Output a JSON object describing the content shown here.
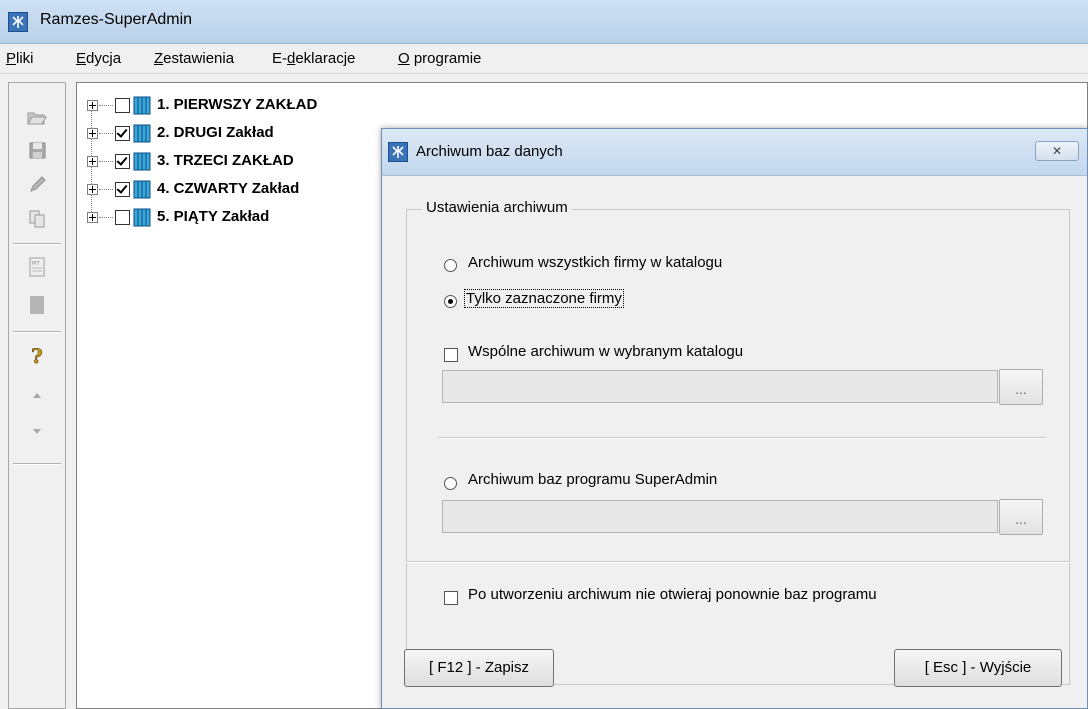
{
  "window": {
    "title": "Ramzes-SuperAdmin"
  },
  "menu": [
    {
      "label": "Pliki",
      "accel": "P"
    },
    {
      "label": "Edycja",
      "accel": "E"
    },
    {
      "label": "Zestawienia",
      "accel": "Z"
    },
    {
      "label": "E-deklaracje",
      "accel": "d"
    },
    {
      "label": "O programie",
      "accel": "O"
    }
  ],
  "toolbar": {
    "buttons": [
      "open-icon",
      "save-icon",
      "edit-icon",
      "copy-icon",
      "pit-icon",
      "block-icon",
      "help-icon",
      "up-arrow-icon",
      "down-arrow-icon"
    ]
  },
  "tree": {
    "items": [
      {
        "label": "1. PIERWSZY ZAKŁAD",
        "checked": false
      },
      {
        "label": "2. DRUGI Zakład",
        "checked": true
      },
      {
        "label": "3. TRZECI ZAKŁAD",
        "checked": true
      },
      {
        "label": "4. CZWARTY Zakład",
        "checked": true
      },
      {
        "label": "5. PIĄTY Zakład",
        "checked": false
      }
    ]
  },
  "dialog": {
    "title": "Archiwum baz danych",
    "close_label": "✕",
    "group_label": "Ustawienia archiwum",
    "radio_all": "Archiwum wszystkich firmy w katalogu",
    "radio_selected": "Tylko zaznaczone firmy",
    "radio_selected_checked": true,
    "shared_archive_label": "Wspólne archiwum w wybranym katalogu",
    "shared_archive_path": "",
    "browse_label": "...",
    "radio_superadmin": "Archiwum baz programu SuperAdmin",
    "superadmin_path": "",
    "no_reopen_label": "Po utworzeniu archiwum nie otwieraj ponownie baz programu",
    "save_button": "[ F12 ] - Zapisz",
    "exit_button": "[ Esc ] - Wyjście"
  }
}
